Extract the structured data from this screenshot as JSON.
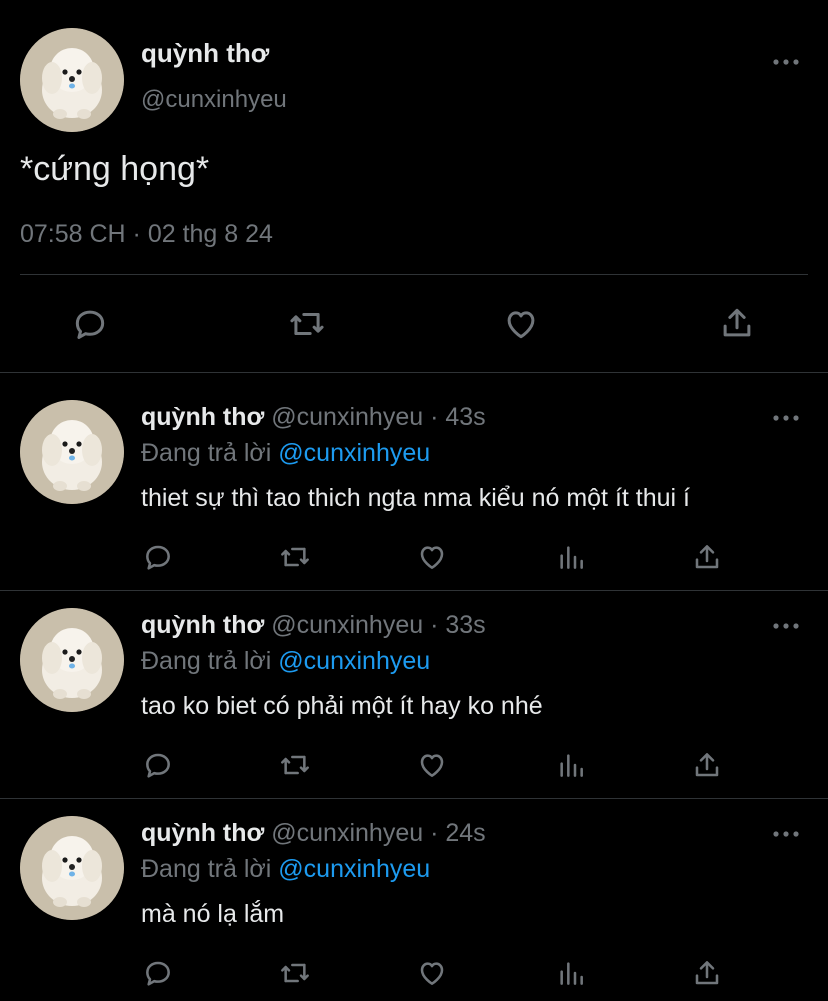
{
  "main_tweet": {
    "display_name": "quỳnh thơ",
    "handle": "@cunxinhyeu",
    "text": "*cứng họng*",
    "timestamp": "07:58 CH · 02 thg 8 24",
    "more_icon": "more-icon",
    "actions": [
      "reply-icon",
      "retweet-icon",
      "like-icon",
      "share-icon"
    ]
  },
  "replies": [
    {
      "display_name": "quỳnh thơ",
      "handle": "@cunxinhyeu",
      "time": "· 43s",
      "replying_prefix": "Đang trả lời",
      "replying_to": "@cunxinhyeu",
      "text": "thiet sự thì tao thich ngta nma kiểu nó một ít thui í"
    },
    {
      "display_name": "quỳnh thơ",
      "handle": "@cunxinhyeu",
      "time": "· 33s",
      "replying_prefix": "Đang trả lời",
      "replying_to": "@cunxinhyeu",
      "text": "tao ko biet có phải một ít hay ko nhé"
    },
    {
      "display_name": "quỳnh thơ",
      "handle": "@cunxinhyeu",
      "time": "· 24s",
      "replying_prefix": "Đang trả lời",
      "replying_to": "@cunxinhyeu",
      "text": "mà nó lạ lắm"
    }
  ],
  "colors": {
    "background": "#000000",
    "text": "#e7e9ea",
    "muted": "#71767b",
    "link": "#1d9bf0",
    "divider": "#2f3336"
  }
}
